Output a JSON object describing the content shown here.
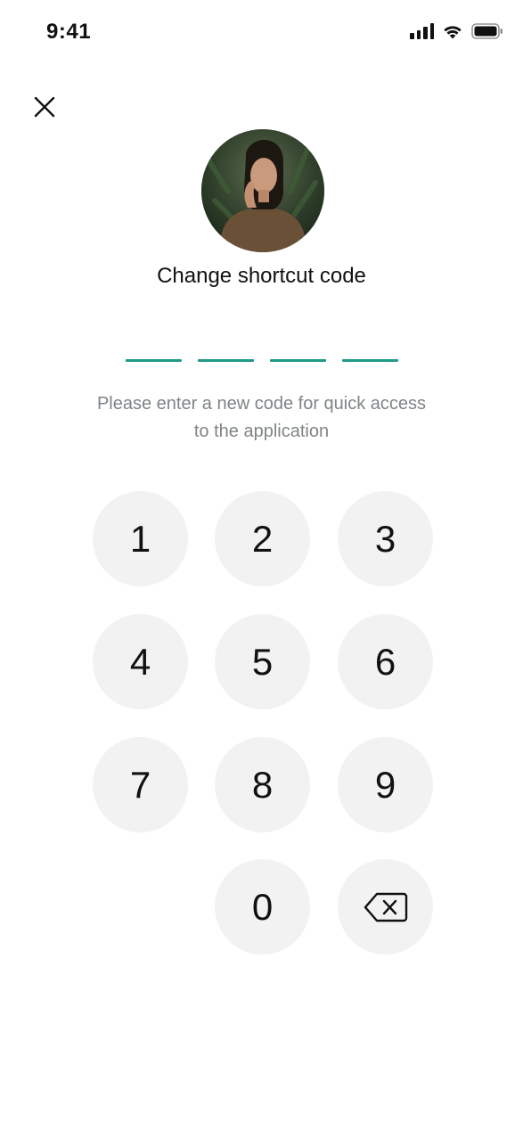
{
  "status_bar": {
    "time": "9:41",
    "icons": [
      "cellular-signal-icon",
      "wifi-icon",
      "battery-icon"
    ]
  },
  "header": {
    "close_icon": "close-icon",
    "avatar_alt": "profile-photo"
  },
  "title": "Change shortcut code",
  "code": {
    "length": 4,
    "accent_color": "#1f9a86",
    "entered": ""
  },
  "hint": "Please enter a new code for quick access to the application",
  "keypad": {
    "keys": [
      "1",
      "2",
      "3",
      "4",
      "5",
      "6",
      "7",
      "8",
      "9",
      "0"
    ],
    "delete_icon": "backspace-icon",
    "key_background": "#f2f2f2"
  }
}
